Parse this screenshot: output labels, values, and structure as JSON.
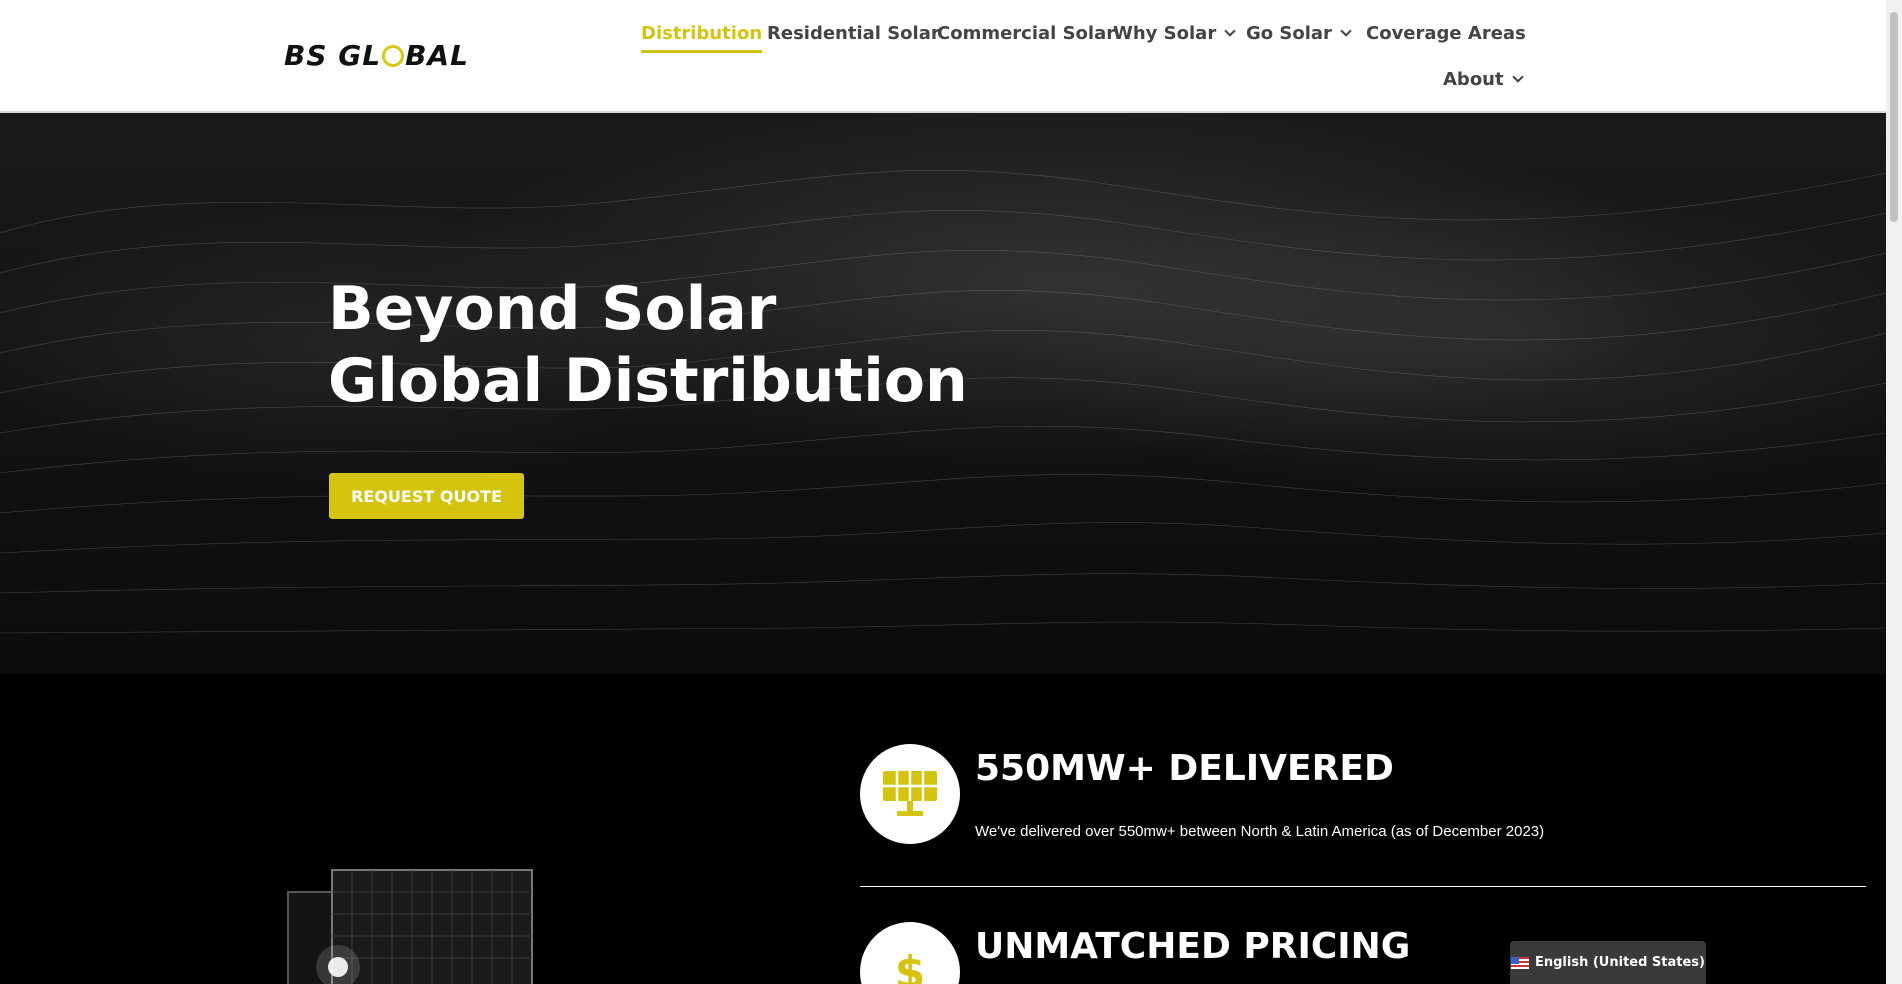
{
  "header": {
    "logo_text_1": "BS GL",
    "logo_text_2": "BAL",
    "nav": [
      {
        "label": "Distribution",
        "active": true
      },
      {
        "label": "Residential Solar"
      },
      {
        "label": "Commercial Solar"
      },
      {
        "label": "Why Solar",
        "dropdown": true
      },
      {
        "label": "Go Solar",
        "dropdown": true
      },
      {
        "label": "Coverage Areas"
      },
      {
        "label": "About",
        "dropdown": true
      }
    ]
  },
  "hero": {
    "title_line_1": "Beyond Solar",
    "title_line_2": "Global Distribution",
    "cta_label": "REQUEST QUOTE"
  },
  "features": [
    {
      "icon": "solar-panel-icon",
      "title": "550MW+ DELIVERED",
      "description": "We've delivered over 550mw+ between North & Latin America (as of December 2023)"
    },
    {
      "icon": "dollar-icon",
      "symbol": "$",
      "title": "UNMATCHED PRICING"
    }
  ],
  "language": {
    "label": "English (United States)"
  },
  "colors": {
    "accent": "#d4c40e",
    "header_bg": "#ffffff",
    "hero_bg": "#111111",
    "section_bg": "#000000"
  }
}
